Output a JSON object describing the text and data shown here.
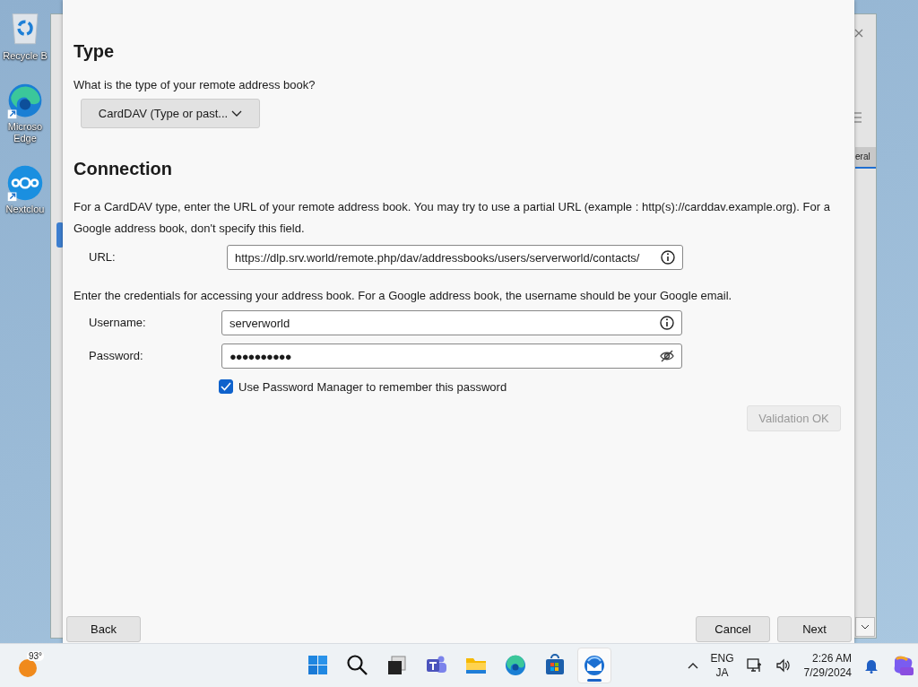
{
  "desktop_icons": [
    {
      "kind": "recycle",
      "label": "Recycle B"
    },
    {
      "kind": "edge",
      "label": "Microso Edge"
    },
    {
      "kind": "nextcloud",
      "label": "Nextclou"
    }
  ],
  "background_window": {
    "tab_label": "eral"
  },
  "dialog": {
    "type_section": {
      "heading": "Type",
      "prompt": "What is the type of your remote address book?",
      "dropdown_value": "CardDAV (Type or past..."
    },
    "connection_section": {
      "heading": "Connection",
      "description": "For a CardDAV type, enter the URL of your remote address book. You may try to use a partial URL (example : http(s)://carddav.example.org). For a Google address book, don't specify this field.",
      "url_label": "URL:",
      "url_value": "https://dlp.srv.world/remote.php/dav/addressbooks/users/serverworld/contacts/",
      "credentials_text": "Enter the credentials for accessing your address book. For a Google address book, the username should be your Google email.",
      "username_label": "Username:",
      "username_value": "serverworld",
      "password_label": "Password:",
      "password_value": "●●●●●●●●●●",
      "remember": {
        "label": "Use Password Manager to remember this password",
        "checked": true
      },
      "validate_button": {
        "label": "Validation OK",
        "disabled": true
      }
    },
    "buttons": [
      {
        "label": "Back"
      },
      {
        "label": "Cancel"
      },
      {
        "label": "Next"
      }
    ]
  },
  "taskbar": {
    "weather": "93°",
    "apps": [
      {
        "kind": "start",
        "selected": false
      },
      {
        "kind": "search",
        "selected": false
      },
      {
        "kind": "taskview",
        "selected": false
      },
      {
        "kind": "teams",
        "selected": false
      },
      {
        "kind": "files",
        "selected": false
      },
      {
        "kind": "edge",
        "selected": false
      },
      {
        "kind": "store",
        "selected": false
      },
      {
        "kind": "thunderbird",
        "selected": true
      }
    ],
    "language": "ENG",
    "input_mode": "JA",
    "time": "2:26 AM",
    "date": "7/29/2024"
  }
}
